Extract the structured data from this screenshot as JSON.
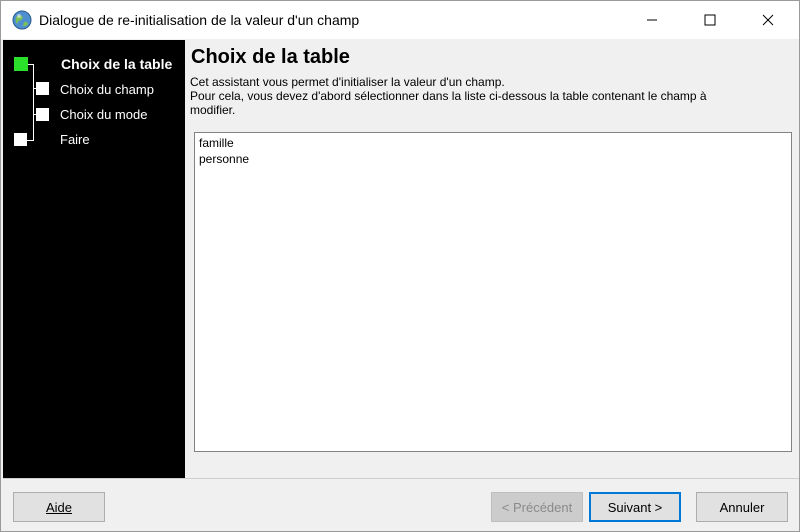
{
  "window": {
    "title": "Dialogue de re-initialisation de la valeur d'un champ"
  },
  "steps": [
    {
      "label": "Choix de la table",
      "state": "active"
    },
    {
      "label": "Choix du champ",
      "state": "pending"
    },
    {
      "label": "Choix du mode",
      "state": "pending"
    },
    {
      "label": "Faire",
      "state": "pending"
    }
  ],
  "main": {
    "heading": "Choix de la table",
    "description_line1": "Cet assistant vous permet d'initialiser la valeur d'un champ.",
    "description_line2": " Pour cela, vous devez d'abord sélectionner dans la liste ci-dessous la table contenant le champ à",
    "description_line3": "modifier.",
    "tables": [
      "famille",
      "personne"
    ]
  },
  "buttons": {
    "help": "Aide",
    "previous": "< Précédent",
    "next": "Suivant >",
    "cancel": "Annuler"
  },
  "colors": {
    "active_step": "#2ae02a",
    "side_panel": "#000000",
    "focus_border": "#0078d7"
  },
  "icons": {
    "app": "globe-icon",
    "minimize": "minimize-icon",
    "maximize": "maximize-icon",
    "close": "close-icon"
  }
}
